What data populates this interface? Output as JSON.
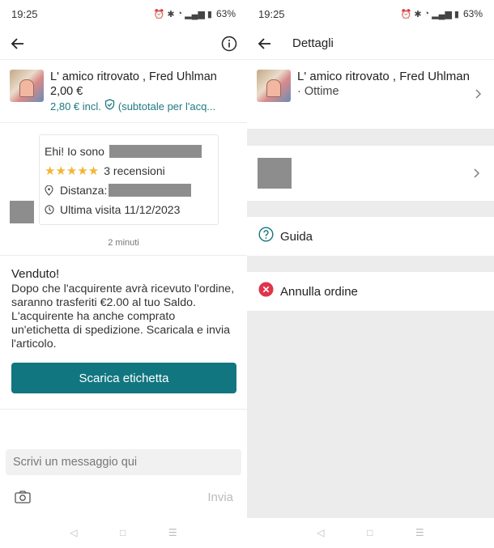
{
  "left": {
    "status": {
      "time": "19:25",
      "battery": "63%"
    },
    "item": {
      "title": "L' amico ritrovato , Fred Uhlman",
      "price": "2,00 €",
      "fee": "2,80 € incl.",
      "fee_note": "(subtotale per l'acq..."
    },
    "profile": {
      "greeting": "Ehi! Io sono",
      "stars": "★★★★★",
      "reviews": "3 recensioni",
      "distance_label": "Distanza:",
      "last_visit": "Ultima visita 11/12/2023"
    },
    "chat_time": "2 minuti",
    "sold": {
      "title": "Venduto!",
      "text": "Dopo che l'acquirente avrà ricevuto l'ordine, saranno trasferiti  €2.00 al tuo Saldo. L'acquirente ha anche comprato un'etichetta di spedizione. Scaricala e invia l'articolo.",
      "button": "Scarica etichetta"
    },
    "message": {
      "placeholder": "Scrivi un messaggio qui",
      "send": "Invia"
    }
  },
  "right": {
    "status": {
      "time": "19:25",
      "battery": "63%"
    },
    "header": {
      "title": "Dettagli"
    },
    "item": {
      "title": "L' amico ritrovato , Fred Uhlman",
      "condition": "· Ottime"
    },
    "rows": {
      "help": "Guida",
      "cancel": "Annulla ordine"
    }
  },
  "colors": {
    "accent": "#127680",
    "accent_text": "#1f7a80",
    "danger": "#e0344a",
    "stars": "#f2b632"
  }
}
